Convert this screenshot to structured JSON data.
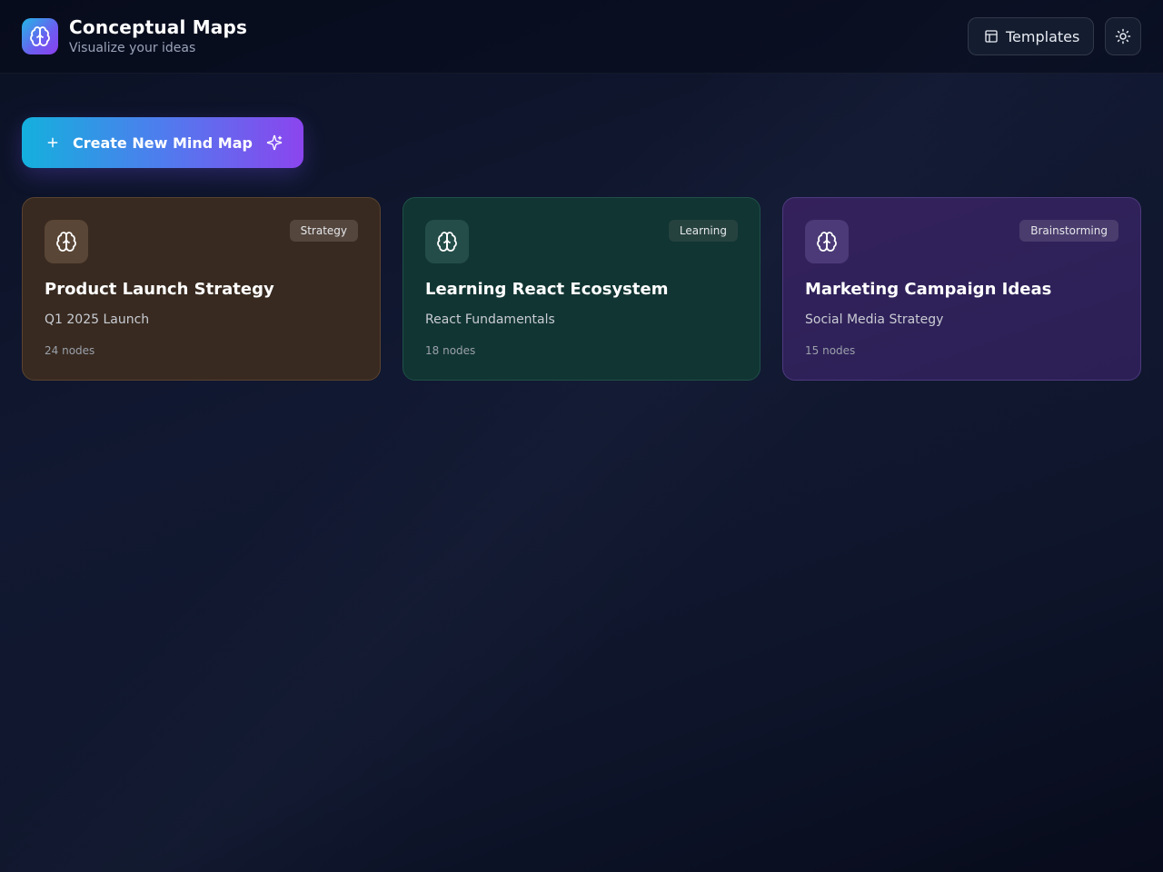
{
  "header": {
    "title": "Conceptual Maps",
    "subtitle": "Visualize your ideas",
    "logo_icon": "brain-icon",
    "templates_label": "Templates",
    "templates_icon": "layout-template-icon",
    "theme_icon": "sun-icon"
  },
  "actions": {
    "create_label": "Create New Mind Map",
    "create_icon": "plus-icon",
    "create_trailing_icon": "sparkles-icon"
  },
  "maps": [
    {
      "title": "Product Launch Strategy",
      "subtitle": "Q1 2025 Launch",
      "nodes": "24 nodes",
      "tag": "Strategy",
      "icon": "brain-icon",
      "color": "#382a20"
    },
    {
      "title": "Learning React Ecosystem",
      "subtitle": "React Fundamentals",
      "nodes": "18 nodes",
      "tag": "Learning",
      "icon": "brain-icon",
      "color": "#113532"
    },
    {
      "title": "Marketing Campaign Ideas",
      "subtitle": "Social Media Strategy",
      "nodes": "15 nodes",
      "tag": "Brainstorming",
      "icon": "brain-icon",
      "color": "#2f2159"
    }
  ],
  "colors": {
    "accent_start": "#14b0dd",
    "accent_end": "#8b45ee",
    "background": "#0f162c"
  }
}
